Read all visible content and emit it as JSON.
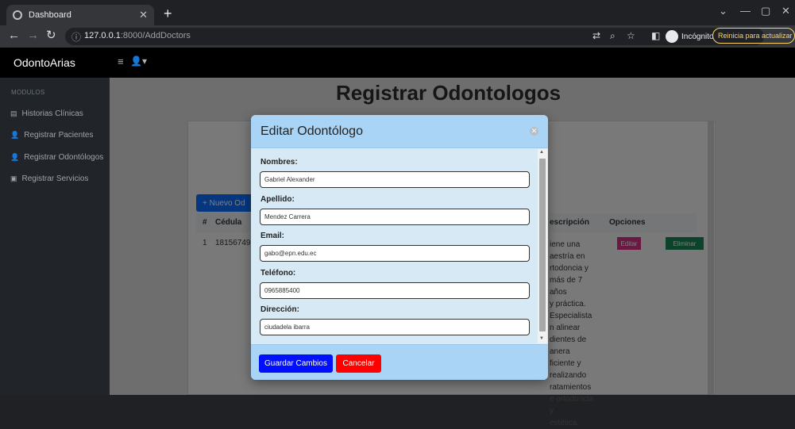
{
  "browser": {
    "tab_title": "Dashboard",
    "url_host": "127.0.0.1",
    "url_path": ":8000/AddDoctors",
    "incognito_label": "Incógnito",
    "update_label": "Reinicia para actualizar",
    "accent_update": "#fdd663"
  },
  "navbar": {
    "brand": "OdontoArias"
  },
  "sidebar": {
    "heading": "MODULOS",
    "items": [
      {
        "label": "Historias Clínicas",
        "icon": "table-icon"
      },
      {
        "label": "Registrar Pacientes",
        "icon": "user-plus-icon"
      },
      {
        "label": "Registrar Odontólogos",
        "icon": "user-plus-icon"
      },
      {
        "label": "Registrar Servicios",
        "icon": "building-icon"
      }
    ]
  },
  "main": {
    "title": "Registrar Odontologos",
    "new_button": "+ Nuevo Od",
    "table": {
      "headers": [
        "#",
        "Cédula",
        "escripción",
        "Opciones"
      ],
      "row": {
        "index": "1",
        "cedula": "18156749",
        "description_lines": [
          "iene una",
          "aestría en",
          "rtodoncia y",
          "más de 7 años",
          "y práctica.",
          "Especialista",
          "n alinear",
          "dientes de",
          "anera",
          "ficiente y",
          "realizando",
          "ratamientos",
          "e ortodoncia y",
          "estética."
        ],
        "edit_label": "Editar",
        "delete_label": "Eliminar"
      }
    }
  },
  "modal": {
    "title": "Editar Odontólogo",
    "fields": [
      {
        "label": "Nombres:",
        "value": "Gabriel Alexander"
      },
      {
        "label": "Apellido:",
        "value": "Mendez Carrera"
      },
      {
        "label": "Email:",
        "value": "gabo@epn.edu.ec"
      },
      {
        "label": "Teléfono:",
        "value": "0965885400"
      },
      {
        "label": "Dirección:",
        "value": "ciudadela ibarra"
      }
    ],
    "save_label": "Guardar Cambios",
    "cancel_label": "Cancelar",
    "colors": {
      "save": "#0010ff",
      "cancel": "#ff0000",
      "header": "#a9d4f5"
    }
  }
}
